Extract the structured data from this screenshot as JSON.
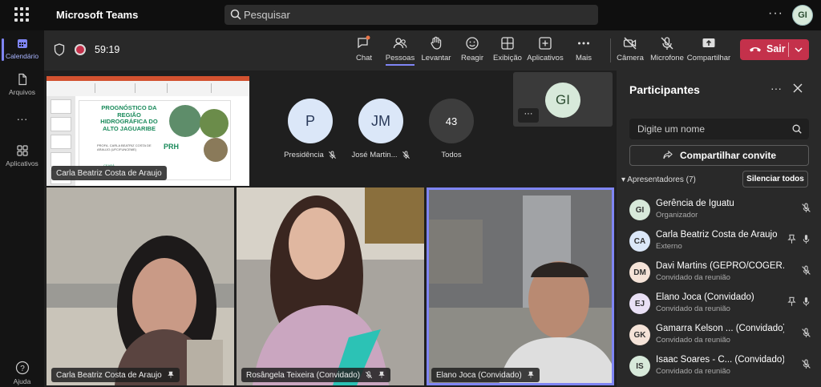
{
  "titlebar": {
    "app_title": "Microsoft Teams",
    "search_placeholder": "Pesquisar",
    "user_initials": "GI"
  },
  "rail": {
    "items": [
      {
        "label": "Calendário",
        "icon": "calendar-icon"
      },
      {
        "label": "Arquivos",
        "icon": "file-icon"
      },
      {
        "label": "",
        "icon": "more-icon"
      },
      {
        "label": "Aplicativos",
        "icon": "apps-icon"
      },
      {
        "label": "Ajuda",
        "icon": "help-icon"
      }
    ]
  },
  "toolbar": {
    "timer": "59:19",
    "buttons": {
      "chat": "Chat",
      "people": "Pessoas",
      "raise": "Levantar",
      "react": "Reagir",
      "view": "Exibição",
      "apps": "Aplicativos",
      "more": "Mais",
      "camera": "Câmera",
      "mic": "Microfone",
      "share": "Compartilhar"
    },
    "leave": "Sair",
    "accent": "#7f85f5",
    "leave_color": "#c4314b"
  },
  "stage": {
    "slide": {
      "title": "PROGNÓSTICO DA REGIÃO HIDROGRÁFICA DO ALTO JAGUARIBE",
      "subtitle": "PROFA. CARLA BEATRIZ COSTA DE ARAUJO (UFC/FUNCEME)",
      "logo": "PRH",
      "footer": "CEARÁ",
      "presenter": "Carla Beatriz Costa de Araujo"
    },
    "people": [
      {
        "initials": "P",
        "name": "Presidência",
        "color": "#dbe7f8"
      },
      {
        "initials": "JM",
        "name": "José Martin...",
        "color": "#dbe7f8"
      },
      {
        "initials": "43",
        "name": "Todos",
        "color": "#3d3d3d"
      }
    ],
    "self_initials": "GI",
    "videos": [
      {
        "name": "Carla Beatriz Costa de Araujo"
      },
      {
        "name": "Rosângela Teixeira (Convidado)"
      },
      {
        "name": "Elano Joca (Convidado)"
      }
    ]
  },
  "panel": {
    "title": "Participantes",
    "input_placeholder": "Digite um nome",
    "invite": "Compartilhar convite",
    "section": "Apresentadores (7)",
    "mute_all": "Silenciar todos",
    "participants": [
      {
        "initials": "GI",
        "name": "Gerência de Iguatu",
        "role": "Organizador",
        "color": "#d7e9da",
        "pinned": false
      },
      {
        "initials": "CA",
        "name": "Carla Beatriz Costa de Araujo",
        "role": "Externo",
        "color": "#dbe7f8",
        "pinned": true
      },
      {
        "initials": "DM",
        "name": "Davi Martins (GEPRO/COGER...",
        "role": "Convidado da reunião",
        "color": "#f5e3d8",
        "pinned": false
      },
      {
        "initials": "EJ",
        "name": "Elano Joca (Convidado)",
        "role": "Convidado da reunião",
        "color": "#e9e0f5",
        "pinned": true
      },
      {
        "initials": "GK",
        "name": "Gamarra Kelson ... (Convidado)",
        "role": "Convidado da reunião",
        "color": "#f5e3d8",
        "pinned": false
      },
      {
        "initials": "IS",
        "name": "Isaac Soares - C... (Convidado)",
        "role": "Convidado da reunião",
        "color": "#d7e9da",
        "pinned": false
      }
    ]
  }
}
